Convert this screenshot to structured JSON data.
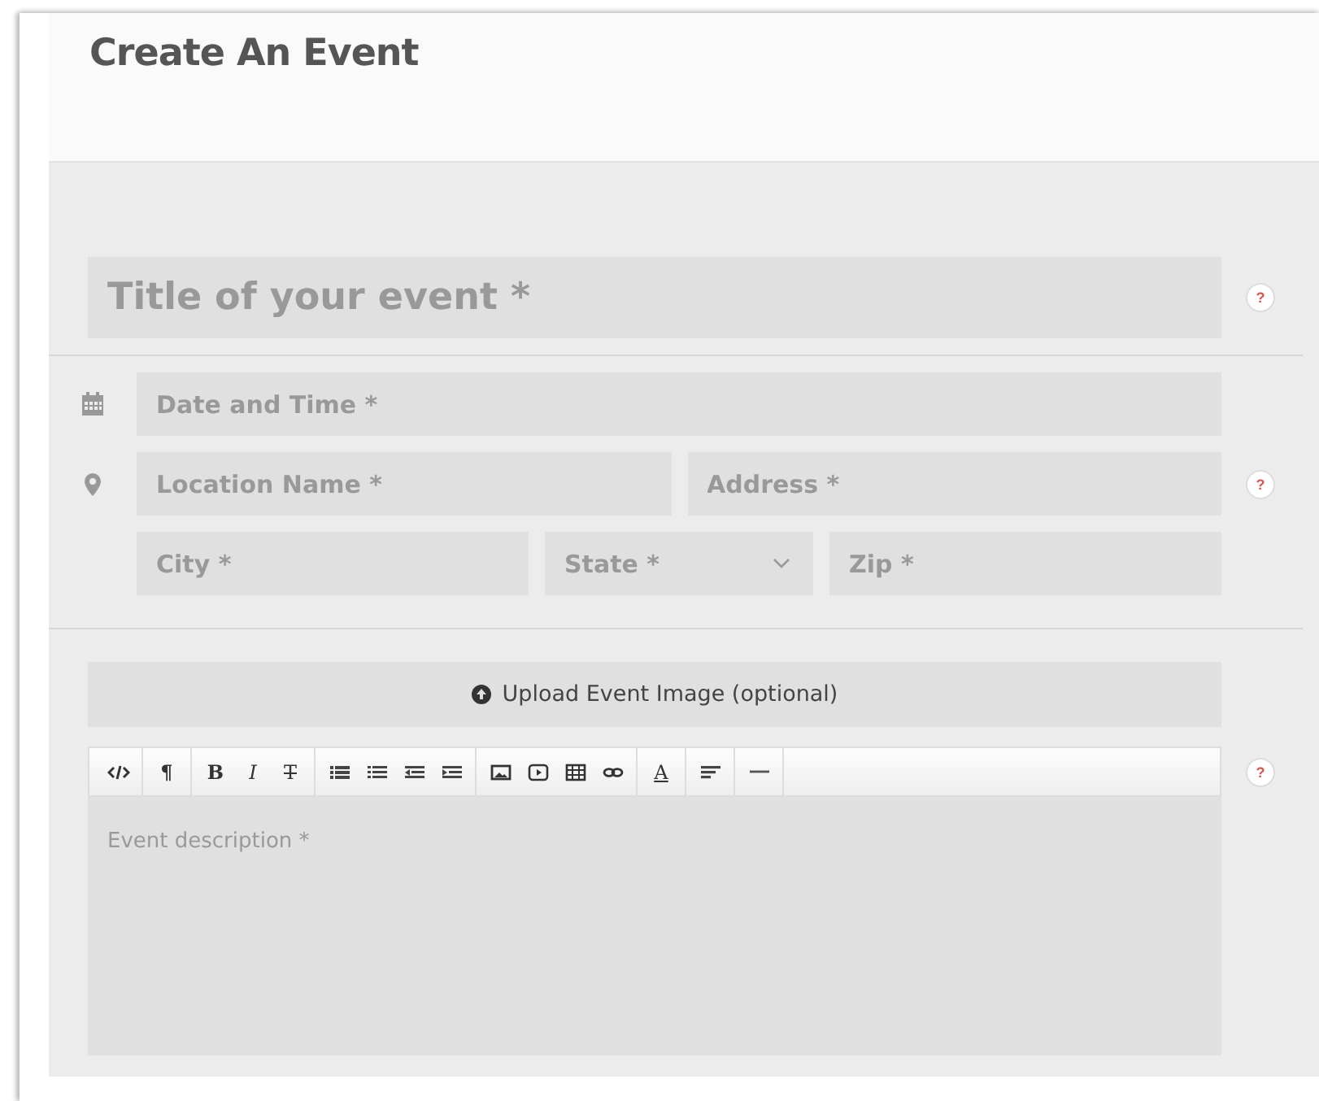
{
  "header": {
    "title": "Create An Event"
  },
  "title_field": {
    "placeholder": "Title of your event *",
    "help": "?"
  },
  "date_field": {
    "placeholder": "Date and Time *"
  },
  "location_row": {
    "fields": [
      {
        "placeholder": "Location Name *"
      },
      {
        "placeholder": "Address *"
      }
    ],
    "help": "?"
  },
  "city_row": {
    "fields": [
      {
        "kind": "input",
        "placeholder": "City *"
      },
      {
        "kind": "select",
        "placeholder": "State *"
      },
      {
        "kind": "input",
        "placeholder": "Zip *"
      }
    ]
  },
  "upload_button": {
    "label": "Upload Event Image (optional)"
  },
  "editor": {
    "help": "?",
    "placeholder": "Event description *",
    "toolbar": [
      [
        {
          "kind": "code"
        }
      ],
      [
        {
          "kind": "paragraph",
          "label": "¶"
        }
      ],
      [
        {
          "kind": "bold",
          "label": "B"
        },
        {
          "kind": "italic",
          "label": "I"
        },
        {
          "kind": "strike",
          "label": "T"
        }
      ],
      [
        {
          "kind": "bullets"
        },
        {
          "kind": "numbers"
        },
        {
          "kind": "outdent"
        },
        {
          "kind": "indent"
        }
      ],
      [
        {
          "kind": "image"
        },
        {
          "kind": "video"
        },
        {
          "kind": "table"
        },
        {
          "kind": "link"
        }
      ],
      [
        {
          "kind": "color",
          "label": "A"
        }
      ],
      [
        {
          "kind": "align"
        }
      ],
      [
        {
          "kind": "rule"
        }
      ]
    ]
  }
}
